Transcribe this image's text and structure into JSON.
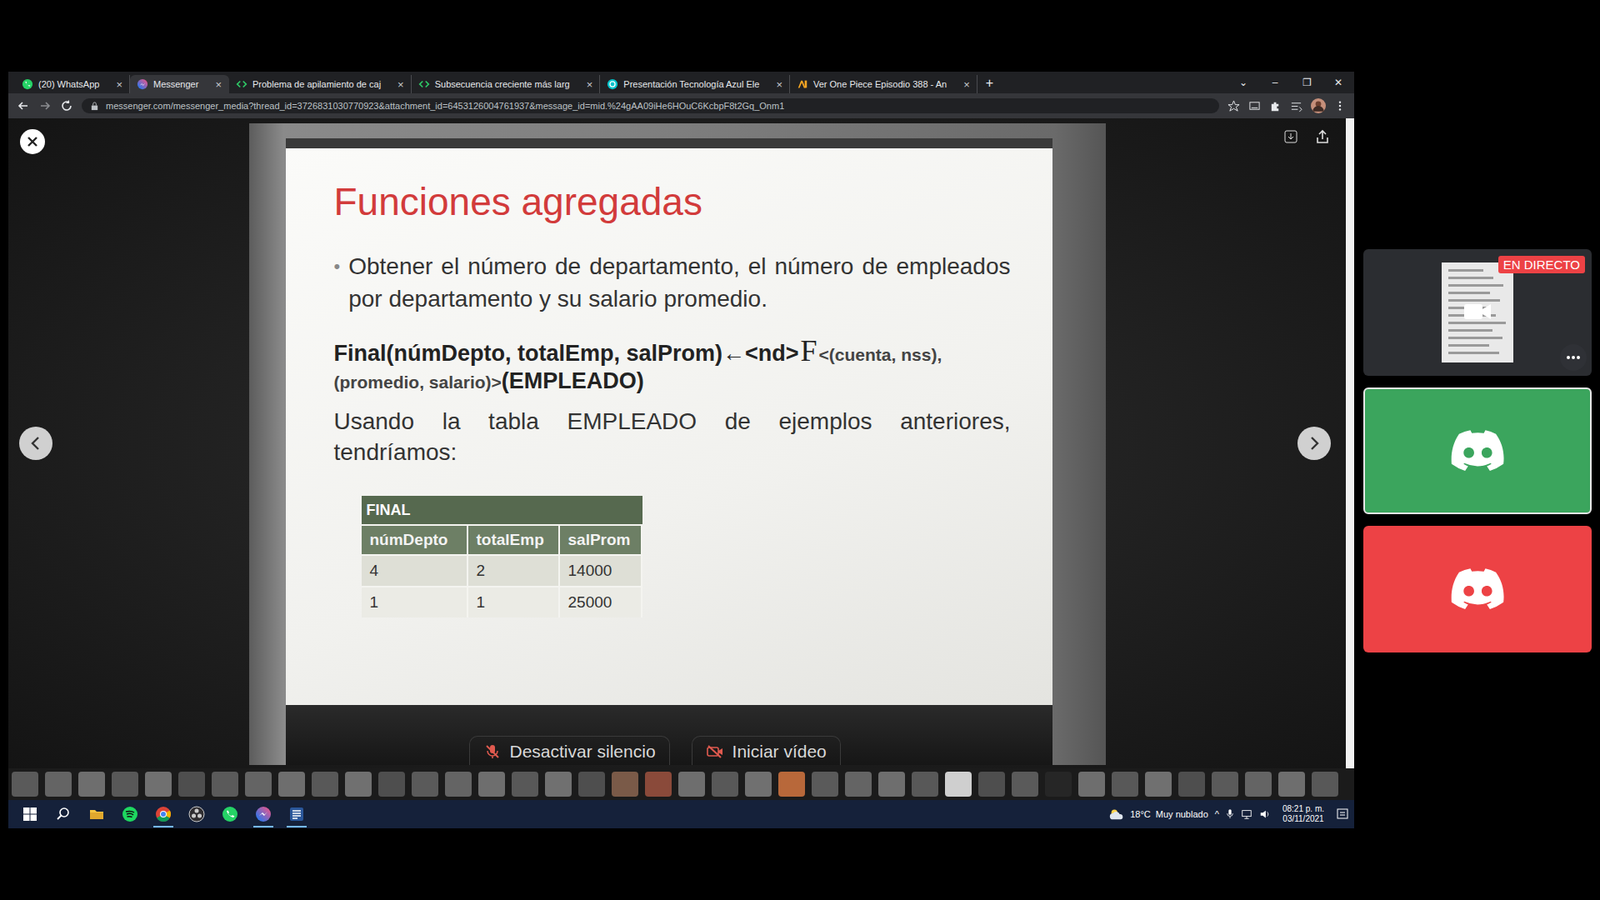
{
  "browser": {
    "tabs": [
      {
        "label": "(20) WhatsApp",
        "selected": false,
        "kind": "whatsapp"
      },
      {
        "label": "Messenger",
        "selected": true,
        "kind": "messenger"
      },
      {
        "label": "Problema de apilamiento de caj",
        "selected": false,
        "kind": "code"
      },
      {
        "label": "Subsecuencia creciente más larg",
        "selected": false,
        "kind": "code"
      },
      {
        "label": "Presentación Tecnología Azul Ele",
        "selected": false,
        "kind": "canva"
      },
      {
        "label": "Ver One Piece Episodio 388 - An",
        "selected": false,
        "kind": "anime"
      }
    ],
    "tab_close": "×",
    "new_tab": "+",
    "window_controls": [
      "⌄",
      "–",
      "❐",
      "✕"
    ],
    "url": "messenger.com/messenger_media?thread_id=3726831030770923&attachment_id=6453126004761937&message_id=mid.%24gAA09iHe6HOuC6KcbpF8t2Gq_Onm1"
  },
  "slide": {
    "title": "Funciones agregadas",
    "bullet_mark": "•",
    "bullet": "Obtener el número de departamento, el número de empleados por departamento y su salario promedio.",
    "formula": {
      "head": "Final(númDepto, totalEmp, salProm)←<nd>",
      "operator": "F",
      "args": "<(cuenta, nss),",
      "args_cont": "(promedio, salario)>",
      "relation": "(EMPLEADO)"
    },
    "usage": "Usando la tabla EMPLEADO de ejemplos anteriores, tendríamos:",
    "table": {
      "title": "FINAL",
      "columns": [
        "númDepto",
        "totalEmp",
        "salProm"
      ],
      "rows": [
        [
          "4",
          "2",
          "14000"
        ],
        [
          "1",
          "1",
          "25000"
        ]
      ]
    }
  },
  "call_controls": [
    {
      "label": "Desactivar silencio",
      "off": true
    },
    {
      "label": "Iniciar vídeo",
      "off": true
    }
  ],
  "stream_panel": {
    "badge": "EN DIRECTO",
    "cards": [
      {
        "kind": "preview",
        "color": "#2b2d31",
        "speaking": false
      },
      {
        "kind": "discord",
        "color": "#3ba55d",
        "speaking": true
      },
      {
        "kind": "discord",
        "color": "#ed4245",
        "speaking": false
      }
    ]
  },
  "taskbar": {
    "apps": [
      {
        "kind": "start",
        "active": false
      },
      {
        "kind": "search",
        "active": false
      },
      {
        "kind": "explorer",
        "active": false
      },
      {
        "kind": "spotify",
        "active": false
      },
      {
        "kind": "chrome",
        "active": true
      },
      {
        "kind": "obs",
        "active": false
      },
      {
        "kind": "whatsapp",
        "active": false
      },
      {
        "kind": "messenger",
        "active": true
      },
      {
        "kind": "word",
        "active": true
      }
    ],
    "weather": {
      "temp": "18°C",
      "condition": "Muy nublado"
    },
    "tray_chevron": "^",
    "time": "08:21 p. m.",
    "date": "03/11/2021"
  }
}
